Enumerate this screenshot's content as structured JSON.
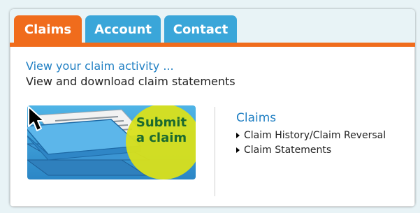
{
  "tabs": [
    {
      "label": "Claims",
      "active": true
    },
    {
      "label": "Account",
      "active": false
    },
    {
      "label": "Contact",
      "active": false
    }
  ],
  "main": {
    "activity_link": "View your claim activity ...",
    "subtitle": "View and download claim statements",
    "banner": {
      "line1": "Submit",
      "line2": "a claim",
      "icon": "tray-icon"
    }
  },
  "claims_panel": {
    "heading": "Claims",
    "items": [
      "Claim History/Claim Reversal",
      "Claim Statements"
    ]
  },
  "colors": {
    "active_tab": "#f06c1c",
    "inactive_tab": "#3aa6d9",
    "link": "#1f7fc3",
    "highlight": "#d9e01a"
  }
}
